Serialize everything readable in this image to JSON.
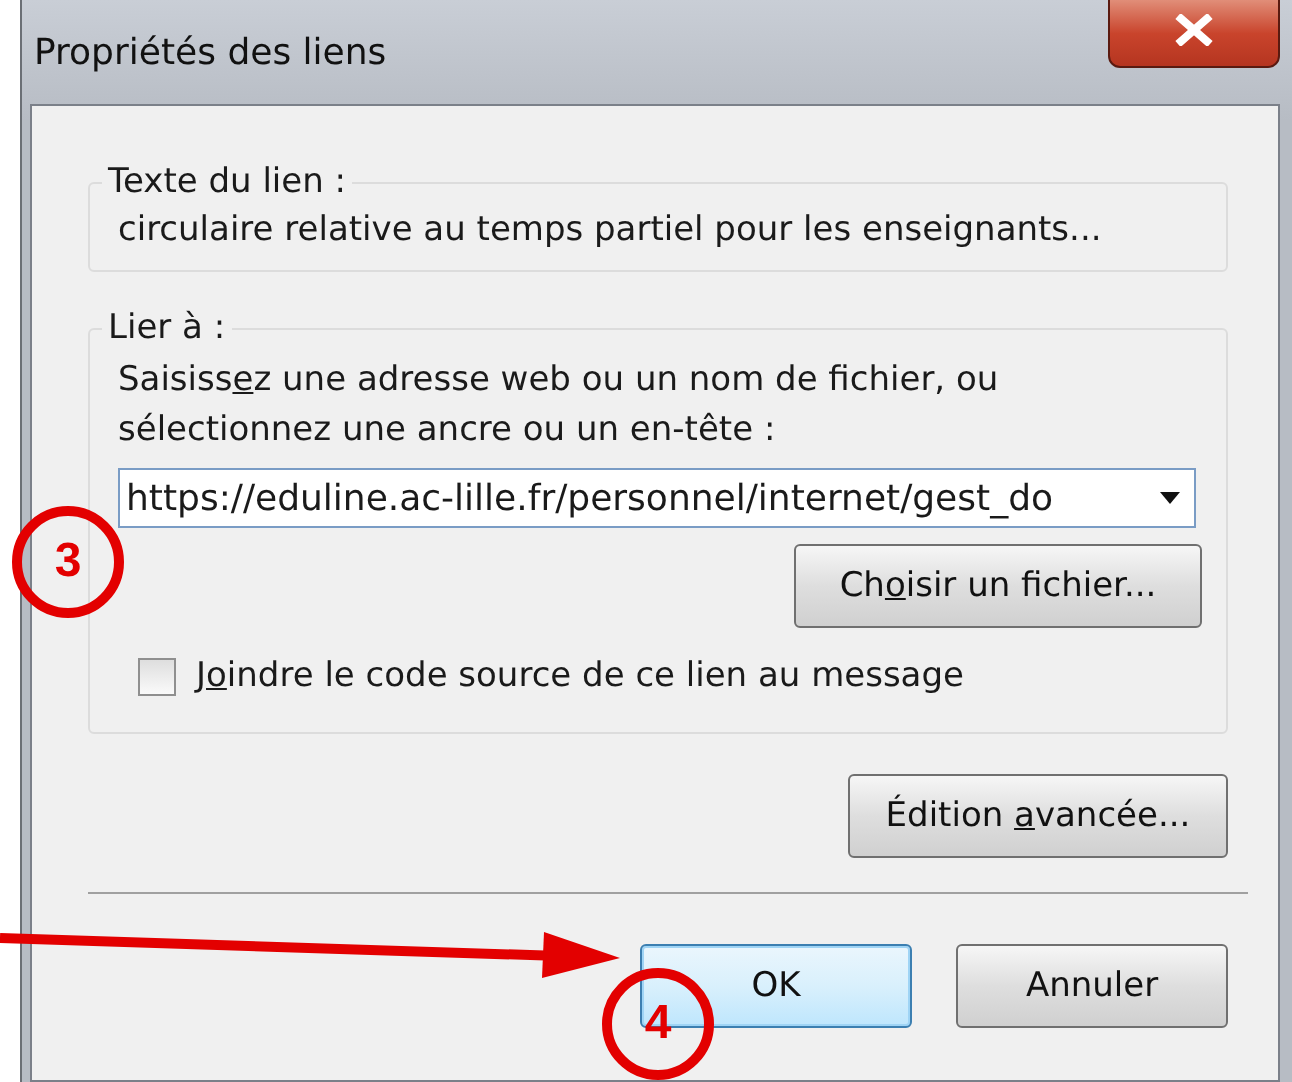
{
  "window": {
    "title": "Propriétés des liens"
  },
  "link_text": {
    "legend": "Texte du lien :",
    "value": "circulaire relative au temps partiel pour les enseignants..."
  },
  "link_to": {
    "legend": "Lier à :",
    "instruction": [
      "Saisiss",
      "e",
      "z une adresse web ou un nom de fichier, ou"
    ],
    "instruction_line2": "sélectionnez une ancre ou un en-tête :",
    "url": "https://eduline.ac-lille.fr/personnel/internet/gest_do",
    "choose_button": [
      "Ch",
      "o",
      "isir un fichier..."
    ],
    "attach_source": {
      "label": [
        "J",
        "o",
        "indre le code source de ce lien au message"
      ],
      "checked": false
    }
  },
  "advanced_button": [
    "Édition ",
    "a",
    "vancée..."
  ],
  "buttons": [
    {
      "label": "OK",
      "default": true
    },
    {
      "label": "Annuler",
      "default": false
    }
  ],
  "annotations": [
    {
      "kind": "circle",
      "label": "3"
    },
    {
      "kind": "circle",
      "label": "4"
    },
    {
      "kind": "arrow"
    }
  ]
}
